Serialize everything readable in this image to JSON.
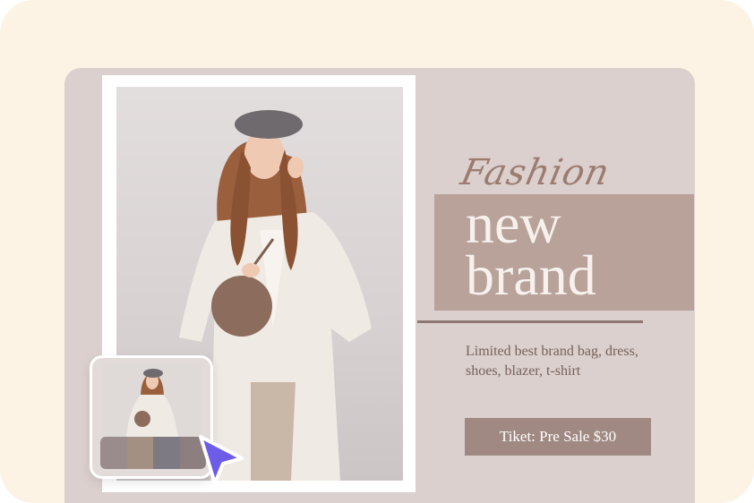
{
  "banner": {
    "script_word": "Fashion",
    "title_line1": "new",
    "title_line2": "brand",
    "description": "Limited best brand bag, dress, shoes, blazer, t-shirt",
    "ticket_label": "Tiket: Pre Sale $30"
  },
  "palette": {
    "swatches": [
      "#9a8c8c",
      "#a48f83",
      "#7e7a83",
      "#8d7f80"
    ]
  },
  "colors": {
    "background": "#fdf3e4",
    "card": "#dbd0cd",
    "title_block": "#b8a299",
    "ticket": "#a08982",
    "cursor": "#6c5ce7"
  },
  "icons": {
    "cursor": "pointer-cursor-icon"
  }
}
